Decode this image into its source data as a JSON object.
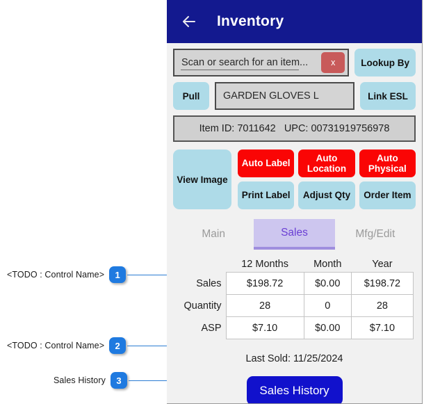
{
  "header": {
    "title": "Inventory",
    "back_icon": "back-arrow-icon"
  },
  "search": {
    "placeholder_text": "Scan or search for an item...",
    "clear_label": "x",
    "lookup_label": "Lookup By"
  },
  "item": {
    "pull_label": "Pull",
    "name": "GARDEN GLOVES L",
    "link_esl_label": "Link ESL",
    "id_upc": "Item ID: 7011642   UPC: 00731919756978"
  },
  "actions": {
    "view_image": "View Image",
    "buttons": [
      {
        "label": "Auto Label",
        "style": "red"
      },
      {
        "label": "Auto Location",
        "style": "red"
      },
      {
        "label": "Auto Physical",
        "style": "red"
      },
      {
        "label": "Print Label",
        "style": "blue"
      },
      {
        "label": "Adjust Qty",
        "style": "blue"
      },
      {
        "label": "Order Item",
        "style": "blue"
      }
    ]
  },
  "tabs": [
    {
      "label": "Main",
      "active": false
    },
    {
      "label": "Sales",
      "active": true
    },
    {
      "label": "Mfg/Edit",
      "active": false
    }
  ],
  "sales_table": {
    "columns": [
      "12 Months",
      "Month",
      "Year"
    ],
    "rows": [
      {
        "label": "Sales",
        "values": [
          "$198.72",
          "$0.00",
          "$198.72"
        ]
      },
      {
        "label": "Quantity",
        "values": [
          "28",
          "0",
          "28"
        ]
      },
      {
        "label": "ASP",
        "values": [
          "$7.10",
          "$0.00",
          "$7.10"
        ]
      }
    ]
  },
  "last_sold": "Last Sold: 11/25/2024",
  "sales_history_button": "Sales History",
  "annotations": [
    {
      "number": "1",
      "label": "<TODO : Control Name>"
    },
    {
      "number": "2",
      "label": "<TODO : Control Name>"
    },
    {
      "number": "3",
      "label": "Sales History"
    }
  ]
}
